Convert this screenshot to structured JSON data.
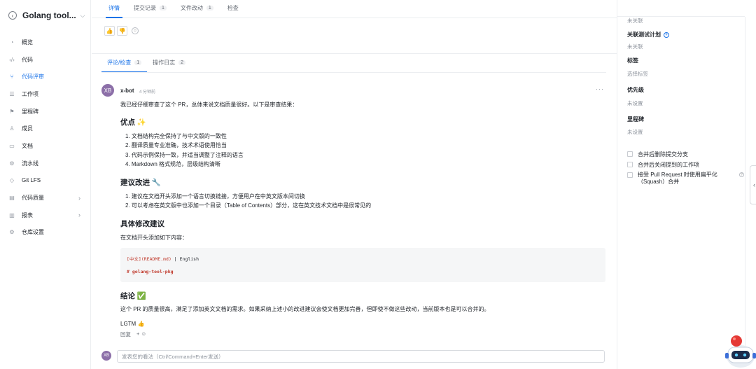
{
  "sidebar": {
    "title": "Golang tool...",
    "items": [
      {
        "label": "概览",
        "icon": "gauge-icon",
        "glyph": "◔"
      },
      {
        "label": "代码",
        "icon": "code-icon",
        "glyph": "‹/›"
      },
      {
        "label": "代码评审",
        "icon": "merge-request-icon",
        "glyph": "⑂",
        "active": true
      },
      {
        "label": "工作项",
        "icon": "list-icon",
        "glyph": "☰"
      },
      {
        "label": "里程碑",
        "icon": "milestone-icon",
        "glyph": "⚑"
      },
      {
        "label": "成员",
        "icon": "members-icon",
        "glyph": "♙"
      },
      {
        "label": "文档",
        "icon": "book-icon",
        "glyph": "▭"
      },
      {
        "label": "流水线",
        "icon": "pipeline-icon",
        "glyph": "⚙"
      },
      {
        "label": "Git LFS",
        "icon": "lfs-icon",
        "glyph": "◇"
      },
      {
        "label": "代码质量",
        "icon": "quality-icon",
        "glyph": "▤",
        "arrow": true
      },
      {
        "label": "报表",
        "icon": "chart-icon",
        "glyph": "▥",
        "arrow": true
      },
      {
        "label": "仓库设置",
        "icon": "settings-icon",
        "glyph": "⚙"
      }
    ]
  },
  "top_tabs": [
    {
      "label": "详情",
      "count": "",
      "active": true
    },
    {
      "label": "提交记录",
      "count": "1"
    },
    {
      "label": "文件改动",
      "count": "1"
    },
    {
      "label": "检查",
      "count": ""
    }
  ],
  "reactions": {
    "thumbs_up": "👍",
    "thumbs_down": "👎",
    "add": "☺"
  },
  "sub_tabs": [
    {
      "label": "评论/检查",
      "count": "1",
      "active": true
    },
    {
      "label": "操作日志",
      "count": "2"
    }
  ],
  "comment": {
    "avatar": "XB",
    "author": "x-bot",
    "time": "4 分钟前",
    "more": "···",
    "intro": "我已经仔细审查了这个 PR，总体来说文档质量很好。以下是审查结果：",
    "h_strengths": "优点 ✨",
    "strengths": [
      "1. 文档结构完全保持了与中文版的一致性",
      "2. 翻译质量专业准确，技术术语使用恰当",
      "3. 代码示例保持一致，并适当调整了注释的语言",
      "4. Markdown 格式规范，层级结构清晰"
    ],
    "h_suggestions": "建议改进 🔧",
    "suggestions": [
      "1. 建议在文档开头添加一个语言切换链接，方便用户在中英文版本间切换",
      "2. 可以考虑在英文版中也添加一个目录（Table of Contents）部分，这在英文技术文档中是很常见的"
    ],
    "h_changes": "具体修改建议",
    "changes_intro": "在文档开头添加如下内容：",
    "code_line1_link": "[中文](README.md)",
    "code_line1_rest": " | English",
    "code_line2": "# golang-tool-pkg",
    "h_conclusion": "结论 ✅",
    "conclusion": "这个 PR 的质量很高，满足了添加英文文档的需求。如果采纳上述小的改进建议会使文档更加完善，但即使不做这些改动，当前版本也是可以合并的。",
    "lgtm": "LGTM 👍",
    "reply": "回复",
    "react": "+ ☺"
  },
  "comment_input": {
    "avatar": "XB",
    "placeholder": "发表您的看法（Ctrl/Command+Enter发送）"
  },
  "right_panel": {
    "top_value": "未关联",
    "test_plan_label": "关联测试计划",
    "test_plan_value": "未关联",
    "tags_label": "标签",
    "tags_value": "选择标签",
    "priority_label": "优先级",
    "priority_value": "未设置",
    "milestone_label": "里程碑",
    "milestone_value": "未设置",
    "options": [
      "合并后删除提交分支",
      "合并后关闭提到的工作项",
      "接受 Pull Request 时使用扁平化（Squash）合并"
    ]
  },
  "colors": {
    "accent": "#1a73e8",
    "avatar": "#8c6fa8"
  }
}
